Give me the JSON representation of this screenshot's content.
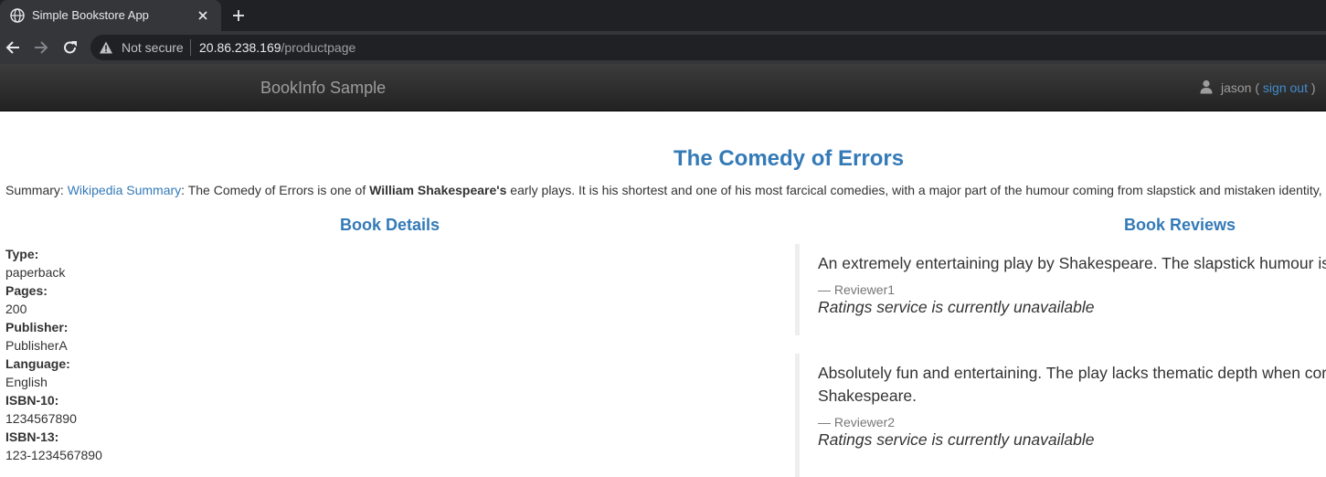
{
  "browser": {
    "tab_title": "Simple Bookstore App",
    "security_label": "Not secure",
    "url_host": "20.86.238.169",
    "url_path": "/productpage"
  },
  "navbar": {
    "brand": "BookInfo Sample",
    "username": "jason",
    "paren_open": " ( ",
    "sign_out": "sign out",
    "paren_close": " )"
  },
  "product": {
    "title": "The Comedy of Errors",
    "summary_prefix": "Summary: ",
    "summary_link": "Wikipedia Summary",
    "summary_text_1": ": The Comedy of Errors is one of ",
    "summary_bold": "William Shakespeare's",
    "summary_text_2": " early plays. It is his shortest and one of his most farcical comedies, with a major part of the humour coming from slapstick and mistaken identity,"
  },
  "details": {
    "heading": "Book Details",
    "fields": [
      {
        "label": "Type:",
        "value": "paperback"
      },
      {
        "label": "Pages:",
        "value": "200"
      },
      {
        "label": "Publisher:",
        "value": "PublisherA"
      },
      {
        "label": "Language:",
        "value": "English"
      },
      {
        "label": "ISBN-10:",
        "value": "1234567890"
      },
      {
        "label": "ISBN-13:",
        "value": "123-1234567890"
      }
    ]
  },
  "reviews": {
    "heading": "Book Reviews",
    "items": [
      {
        "text_line1": "An extremely entertaining play by Shakespeare. The slapstick humour is",
        "text_line2": "",
        "author": "— Reviewer1",
        "rating": "Ratings service is currently unavailable"
      },
      {
        "text_line1": "Absolutely fun and entertaining. The play lacks thematic depth when cor",
        "text_line2": "Shakespeare.",
        "author": "— Reviewer2",
        "rating": "Ratings service is currently unavailable"
      }
    ]
  },
  "colors": {
    "link": "#337ab7",
    "navbar_bg": "#222222",
    "chrome_bg": "#35363a"
  }
}
